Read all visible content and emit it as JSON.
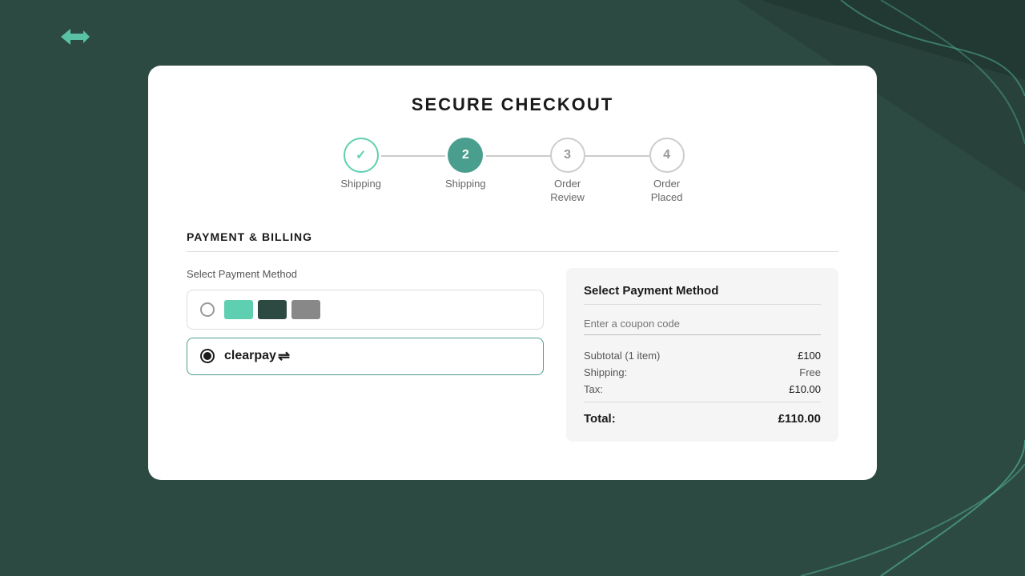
{
  "background": {
    "color": "#2d4a42"
  },
  "logo": {
    "label": "↔"
  },
  "card": {
    "title": "SECURE CHECKOUT"
  },
  "stepper": {
    "steps": [
      {
        "id": 1,
        "label": "Shipping",
        "state": "completed",
        "icon": "✓"
      },
      {
        "id": 2,
        "label": "Shipping",
        "state": "active"
      },
      {
        "id": 3,
        "label": "Order\nReview",
        "state": "inactive"
      },
      {
        "id": 4,
        "label": "Order\nPlaced",
        "state": "inactive"
      }
    ]
  },
  "payment_billing": {
    "section_title": "PAYMENT & BILLING",
    "select_label": "Select Payment Method",
    "options": [
      {
        "id": "card",
        "selected": false,
        "type": "card-icons"
      },
      {
        "id": "clearpay",
        "selected": true,
        "type": "clearpay"
      }
    ]
  },
  "order_summary": {
    "title": "Select Payment Method",
    "coupon_placeholder": "Enter a coupon code",
    "subtotal_label": "Subtotal (1 item)",
    "subtotal_value": "£100",
    "shipping_label": "Shipping:",
    "shipping_value": "Free",
    "tax_label": "Tax:",
    "tax_value": "£10.00",
    "total_label": "Total:",
    "total_value": "£110.00"
  }
}
